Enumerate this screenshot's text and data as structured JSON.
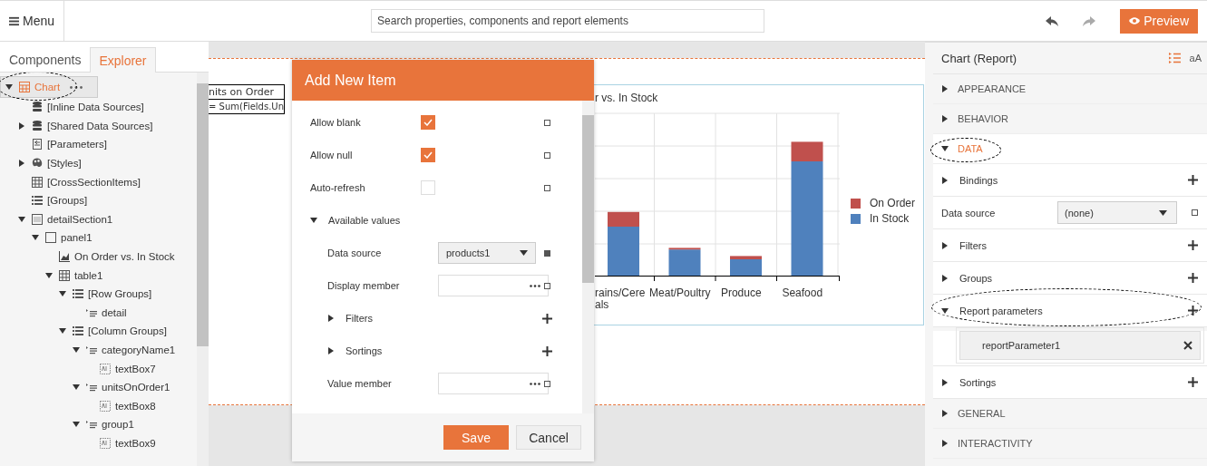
{
  "toolbar": {
    "menu": "Menu",
    "search_placeholder": "Search properties, components and report elements",
    "preview": "Preview"
  },
  "left_tabs": [
    {
      "label": "Components",
      "selected": false
    },
    {
      "label": "Explorer",
      "selected": true
    }
  ],
  "tree": [
    {
      "label": "Chart",
      "kind": "report",
      "selected": true,
      "expanded": true,
      "highlighted": true,
      "children": [
        {
          "label": "[Inline Data Sources]",
          "kind": "database",
          "selected": false,
          "highlighted": false
        },
        {
          "label": "[Shared Data Sources]",
          "kind": "database",
          "selected": false,
          "expanded": false,
          "highlighted": false
        },
        {
          "label": "[Parameters]",
          "kind": "parameters",
          "selected": false,
          "highlighted": false
        },
        {
          "label": "[Styles]",
          "kind": "palette",
          "selected": false,
          "expanded": false,
          "highlighted": false
        },
        {
          "label": "[CrossSectionItems]",
          "kind": "grid",
          "selected": false,
          "highlighted": false
        },
        {
          "label": "[Groups]",
          "kind": "groups",
          "selected": false,
          "highlighted": false
        },
        {
          "label": "detailSection1",
          "kind": "section",
          "selected": false,
          "expanded": true,
          "highlighted": false,
          "children": [
            {
              "label": "panel1",
              "kind": "panel",
              "selected": false,
              "expanded": true,
              "highlighted": false,
              "children": [
                {
                  "label": "On Order vs. In Stock",
                  "kind": "graph",
                  "selected": false,
                  "highlighted": false
                },
                {
                  "label": "table1",
                  "kind": "grid",
                  "selected": false,
                  "expanded": true,
                  "highlighted": false,
                  "children": [
                    {
                      "label": "[Row Groups]",
                      "kind": "groups",
                      "selected": false,
                      "expanded": true,
                      "highlighted": false,
                      "children": [
                        {
                          "label": "detail",
                          "kind": "group",
                          "selected": false,
                          "highlighted": false
                        }
                      ]
                    },
                    {
                      "label": "[Column Groups]",
                      "kind": "groups",
                      "selected": false,
                      "expanded": true,
                      "highlighted": false,
                      "children": [
                        {
                          "label": "categoryName1",
                          "kind": "group",
                          "selected": false,
                          "expanded": true,
                          "highlighted": false,
                          "children": [
                            {
                              "label": "textBox7",
                              "kind": "textbox",
                              "selected": false,
                              "highlighted": false
                            }
                          ]
                        },
                        {
                          "label": "unitsOnOrder1",
                          "kind": "group",
                          "selected": false,
                          "expanded": true,
                          "highlighted": false,
                          "children": [
                            {
                              "label": "textBox8",
                              "kind": "textbox",
                              "selected": false,
                              "highlighted": false
                            }
                          ]
                        },
                        {
                          "label": "group1",
                          "kind": "group",
                          "selected": false,
                          "expanded": true,
                          "highlighted": false,
                          "children": [
                            {
                              "label": "textBox9",
                              "kind": "textbox",
                              "selected": false,
                              "highlighted": false
                            }
                          ]
                        }
                      ]
                    }
                  ]
                }
              ]
            }
          ]
        }
      ]
    }
  ],
  "report": {
    "textbox_lines": [
      "nits on Order",
      "= Sum(Fields.Un"
    ],
    "chart": {
      "title": "r vs. In Stock",
      "categories": [
        "rains/Cere als",
        "Meat/Poultry",
        "Produce",
        "Seafood"
      ],
      "legend": [
        {
          "label": "On Order",
          "color": "#c0504d"
        },
        {
          "label": "In Stock",
          "color": "#4f81bd"
        }
      ]
    }
  },
  "dialog": {
    "title": "Add New Item",
    "fields": [
      {
        "kind": "checkbox",
        "label": "Allow blank",
        "checked": true,
        "bound": false
      },
      {
        "kind": "checkbox",
        "label": "Allow null",
        "checked": true,
        "bound": false
      },
      {
        "kind": "checkbox",
        "label": "Auto-refresh",
        "checked": false,
        "bound": false
      },
      {
        "kind": "group",
        "label": "Available values",
        "expanded": true,
        "children": [
          {
            "kind": "select",
            "label": "Data source",
            "value": "products1",
            "bound": true
          },
          {
            "kind": "picker",
            "label": "Display member",
            "bound": false
          },
          {
            "kind": "collection",
            "label": "Filters",
            "expanded": false
          },
          {
            "kind": "collection",
            "label": "Sortings",
            "expanded": false
          },
          {
            "kind": "picker",
            "label": "Value member",
            "bound": false
          }
        ]
      }
    ],
    "buttons": [
      {
        "label": "Save",
        "kind": "primary"
      },
      {
        "label": "Cancel",
        "kind": "secondary"
      }
    ]
  },
  "properties": {
    "title": "Chart (Report)",
    "font_toggle": "aA",
    "categories": [
      {
        "label": "APPEARANCE",
        "expanded": false,
        "highlighted": false
      },
      {
        "label": "BEHAVIOR",
        "expanded": false,
        "highlighted": false
      },
      {
        "label": "DATA",
        "expanded": true,
        "highlighted": true,
        "children": [
          {
            "kind": "collection",
            "label": "Bindings",
            "expanded": false,
            "highlighted": false
          },
          {
            "kind": "select",
            "label": "Data source",
            "value": "(none)",
            "bound": false
          },
          {
            "kind": "collection",
            "label": "Filters",
            "expanded": false,
            "highlighted": false
          },
          {
            "kind": "collection",
            "label": "Groups",
            "expanded": false,
            "highlighted": false
          },
          {
            "kind": "collection",
            "label": "Report parameters",
            "expanded": true,
            "highlighted": true,
            "items": [
              "reportParameter1"
            ]
          },
          {
            "kind": "collection",
            "label": "Sortings",
            "expanded": false,
            "highlighted": false
          }
        ]
      },
      {
        "label": "GENERAL",
        "expanded": false,
        "highlighted": false
      },
      {
        "label": "INTERACTIVITY",
        "expanded": false,
        "highlighted": false
      }
    ]
  }
}
